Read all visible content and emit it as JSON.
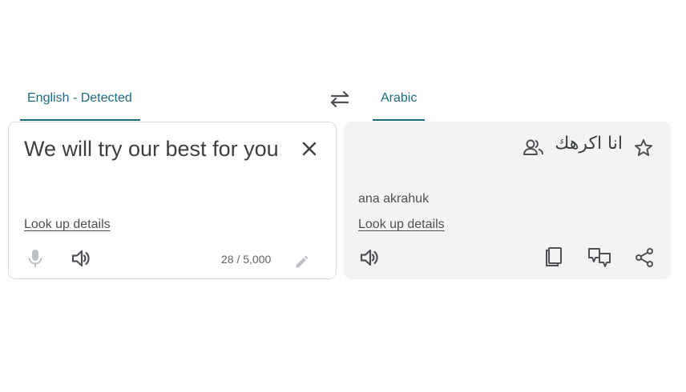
{
  "source_language": {
    "label": "English - Detected"
  },
  "target_language": {
    "label": "Arabic"
  },
  "source": {
    "text": "We will try our best for you",
    "lookup_label": "Look up details",
    "char_count": "28 / 5,000"
  },
  "target": {
    "text": "انا اكرهك",
    "transliteration": "ana akrahuk",
    "lookup_label": "Look up details"
  },
  "colors": {
    "accent": "#1a6a86",
    "icon": "#4d5156",
    "target_panel_bg": "#f3f3f3",
    "border": "#dadce0"
  },
  "icons": {
    "swap": "swap-icon",
    "clear": "close-icon",
    "mic": "mic-icon",
    "speaker": "speaker-icon",
    "edit": "pencil-icon",
    "gender": "people-icon",
    "star": "star-icon",
    "copy": "copy-icon",
    "feedback": "rate-icon",
    "share": "share-icon"
  }
}
